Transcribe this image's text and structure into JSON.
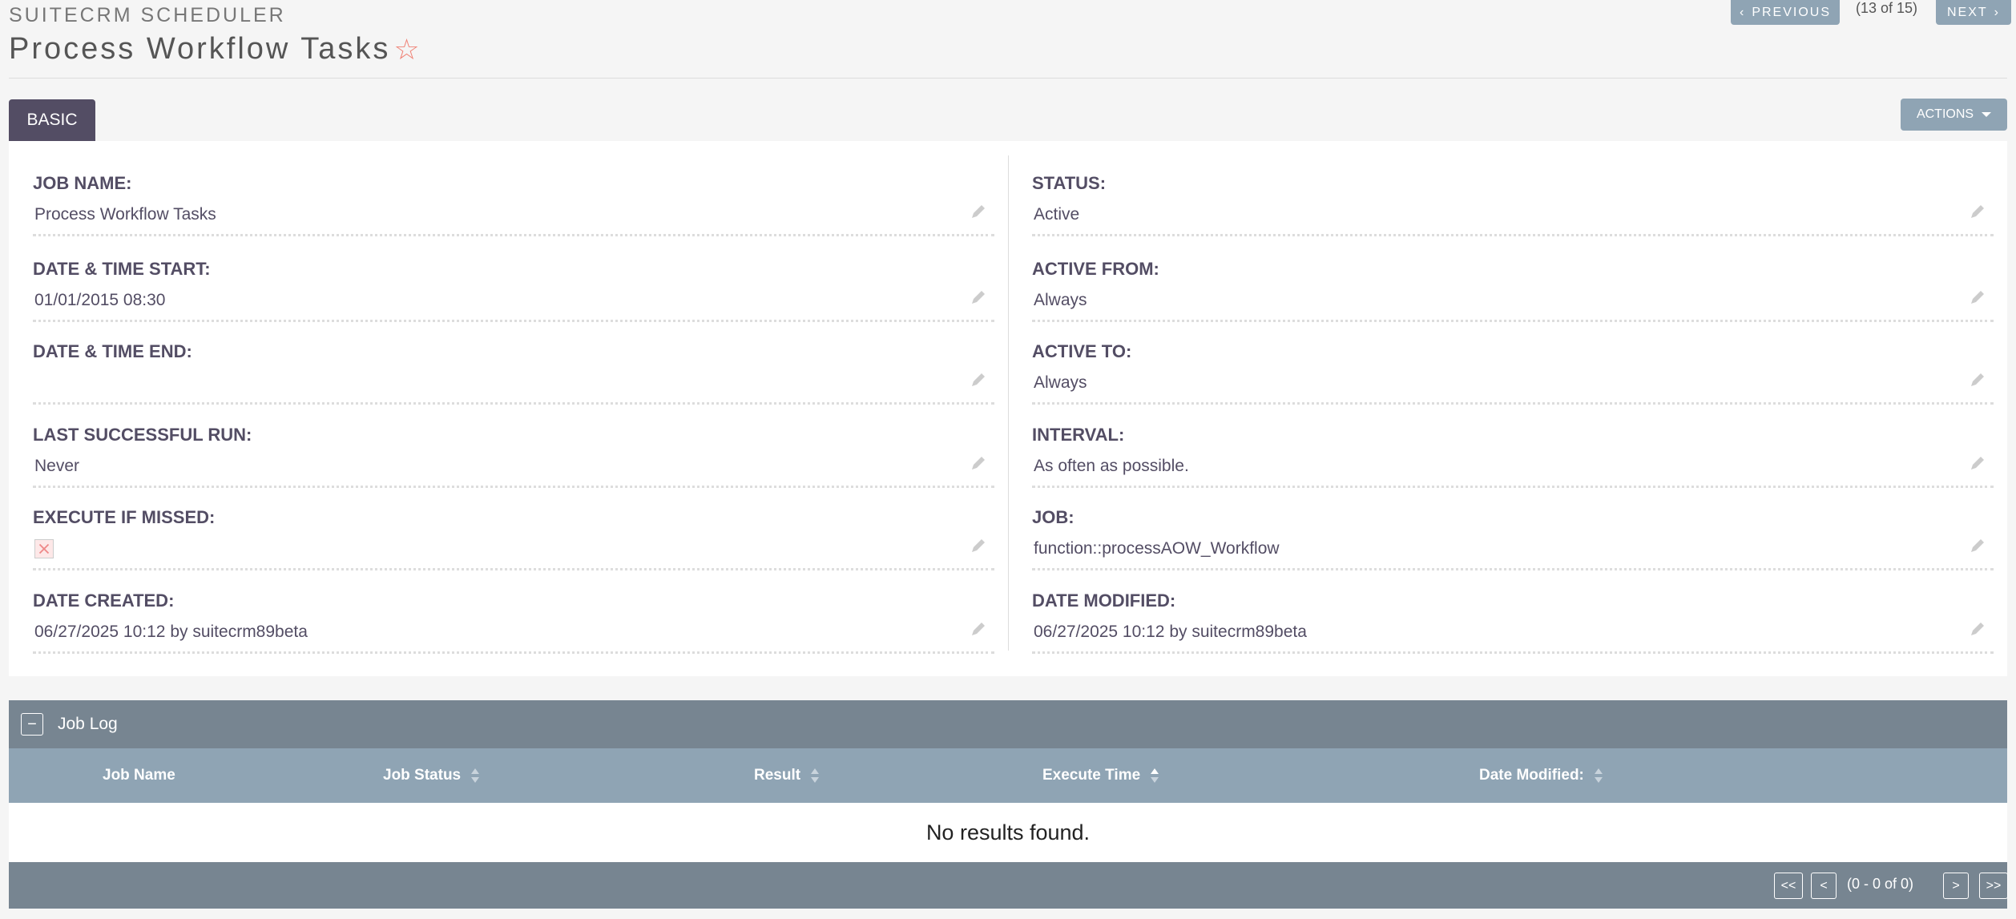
{
  "header": {
    "module": "SUITECRM SCHEDULER",
    "title": "Process Workflow Tasks",
    "prev_label": "PREVIOUS",
    "next_label": "NEXT",
    "record_position": "(13 of 15)"
  },
  "tabs": {
    "basic": "BASIC"
  },
  "actions_label": "ACTIONS",
  "fields_left": [
    {
      "label": "JOB NAME:",
      "value": "Process Workflow Tasks"
    },
    {
      "label": "DATE & TIME START:",
      "value": "01/01/2015 08:30"
    },
    {
      "label": "DATE & TIME END:",
      "value": ""
    },
    {
      "label": "LAST SUCCESSFUL RUN:",
      "value": "Never"
    },
    {
      "label": "EXECUTE IF MISSED:",
      "value": ""
    },
    {
      "label": "DATE CREATED:",
      "value": "06/27/2025 10:12 by suitecrm89beta"
    }
  ],
  "fields_right": [
    {
      "label": "STATUS:",
      "value": "Active"
    },
    {
      "label": "ACTIVE FROM:",
      "value": "Always"
    },
    {
      "label": "ACTIVE TO:",
      "value": "Always"
    },
    {
      "label": "INTERVAL:",
      "value": "As often as possible."
    },
    {
      "label": "JOB:",
      "value": "function::processAOW_Workflow"
    },
    {
      "label": "DATE MODIFIED:",
      "value": "06/27/2025 10:12 by suitecrm89beta"
    }
  ],
  "job_log": {
    "title": "Job Log",
    "collapse_symbol": "−",
    "columns": [
      "Job Name",
      "Job Status",
      "Result",
      "Execute Time",
      "Date Modified:"
    ],
    "empty_text": "No results found.",
    "pagination": {
      "first": "<<",
      "prev": "<",
      "range": "(0 - 0 of 0)",
      "next": ">",
      "last": ">>"
    }
  },
  "colors": {
    "accent": "#534d64",
    "button": "#8fa4b4",
    "subpanel": "#778591",
    "star": "#f08377"
  }
}
